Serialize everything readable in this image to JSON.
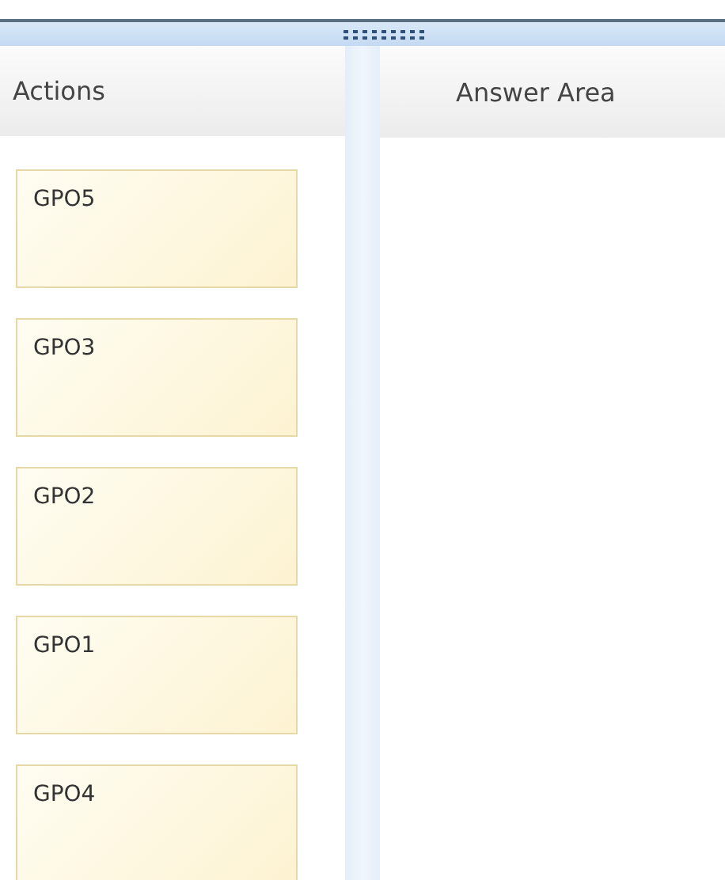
{
  "actions": {
    "title": "Actions",
    "items": [
      {
        "label": "GPO5"
      },
      {
        "label": "GPO3"
      },
      {
        "label": "GPO2"
      },
      {
        "label": "GPO1"
      },
      {
        "label": "GPO4"
      }
    ]
  },
  "answer_area": {
    "title": "Answer Area"
  }
}
